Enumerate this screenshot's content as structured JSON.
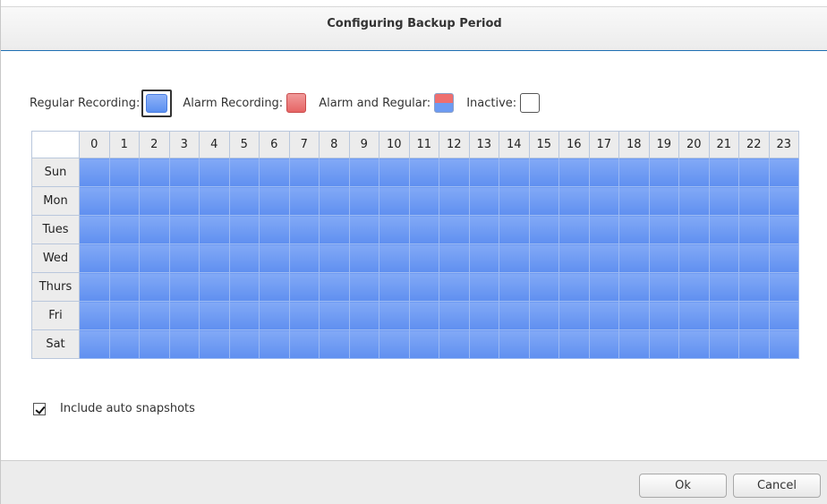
{
  "dialog": {
    "title": "Configuring Backup Period"
  },
  "legend": {
    "regular": "Regular Recording:",
    "alarm": "Alarm Recording:",
    "both": "Alarm and Regular:",
    "inactive": "Inactive:"
  },
  "schedule": {
    "hours": [
      "0",
      "1",
      "2",
      "3",
      "4",
      "5",
      "6",
      "7",
      "8",
      "9",
      "10",
      "11",
      "12",
      "13",
      "14",
      "15",
      "16",
      "17",
      "18",
      "19",
      "20",
      "21",
      "22",
      "23"
    ],
    "days": [
      "Sun",
      "Mon",
      "Tues",
      "Wed",
      "Thurs",
      "Fri",
      "Sat"
    ],
    "mode_all_cells": "regular"
  },
  "options": {
    "auto_snapshots_label": "Include auto snapshots",
    "auto_snapshots_checked": true
  },
  "buttons": {
    "ok": "Ok",
    "cancel": "Cancel"
  },
  "colors": {
    "regular": "#6d9bf2",
    "alarm": "#e66565",
    "accent": "#1e6fb3"
  }
}
